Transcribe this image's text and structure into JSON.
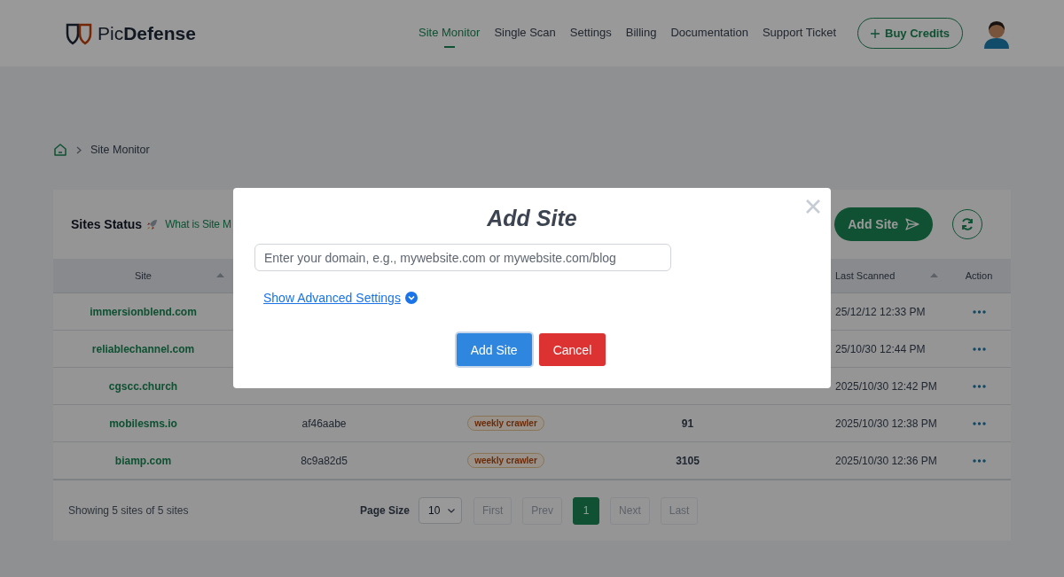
{
  "header": {
    "logo": "Pic**Defense**",
    "nav": [
      {
        "label": "Site Monitor",
        "selected": true
      },
      {
        "label": "Single Scan",
        "selected": false
      },
      {
        "label": "Settings",
        "selected": false
      },
      {
        "label": "Billing",
        "selected": false
      },
      {
        "label": "Documentation",
        "selected": false
      },
      {
        "label": "Support Ticket",
        "selected": false
      }
    ],
    "buy_button": "Buy Credits"
  },
  "breadcrumb": {
    "current": "Site Monitor"
  },
  "card": {
    "title": "Sites Status",
    "help_link": "What is Site M",
    "add_button": "Add Site"
  },
  "table": {
    "site_column": {
      "label": "Site",
      "sort_arrow": true
    },
    "last_scanned_column": {
      "label": "Last Scanned",
      "sort_arrow": true
    },
    "action_column": {
      "label": "Action",
      "sort_arrow": false
    },
    "rows": [
      {
        "site": "immersionblend.com",
        "last_scanned": "25/12/12 12:33 PM"
      },
      {
        "site": "reliablechannel.com",
        "last_scanned": "25/10/30 12:44 PM"
      },
      {
        "site": "cgscc.church",
        "last_scanned": "2025/10/30 12:42 PM"
      },
      {
        "site": "mobilesms.io",
        "hash": "af46aabe",
        "type": "weekly crawler",
        "count": "91",
        "last_scanned": "2025/10/30 12:38 PM"
      },
      {
        "site": "biamp.com",
        "hash": "8c9a82d5",
        "type": "weekly crawler",
        "count": "3105",
        "last_scanned": "2025/10/30 12:36 PM"
      }
    ]
  },
  "footer": {
    "summary": "Showing 5 sites of 5 sites",
    "page_size_label": "Page Size",
    "page_size": "10",
    "pages": [
      {
        "label": "First",
        "selected": false,
        "disabled": true
      },
      {
        "label": "Prev",
        "selected": false,
        "disabled": true
      },
      {
        "label": "1",
        "selected": true,
        "disabled": false
      },
      {
        "label": "Next",
        "selected": false,
        "disabled": true
      },
      {
        "label": "Last",
        "selected": false,
        "disabled": true
      }
    ]
  },
  "modal": {
    "title": "Add Site",
    "placeholder": "Enter your domain, e.g., mywebsite.com or mywebsite.com/blog",
    "advanced_link": "Show Advanced Settings",
    "buttons": [
      {
        "label": "Add Site",
        "kind": "primary"
      },
      {
        "label": "Cancel",
        "kind": "danger"
      }
    ]
  }
}
